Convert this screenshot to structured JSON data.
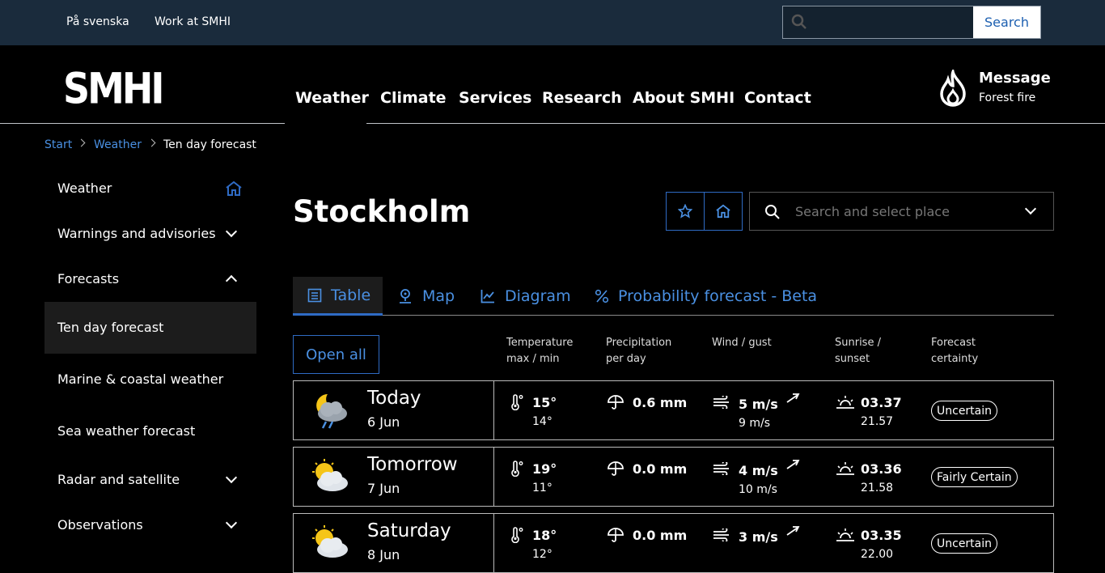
{
  "topbar": {
    "lang_link": "På svenska",
    "work_link": "Work at SMHI",
    "search_button": "Search",
    "search_placeholder": ""
  },
  "header": {
    "logo": "SMHI",
    "nav": [
      "Weather",
      "Climate",
      "Services",
      "Research",
      "About SMHI",
      "Contact"
    ],
    "message_title": "Message",
    "message_subtitle": "Forest fire"
  },
  "breadcrumb": [
    "Start",
    "Weather",
    "Ten day forecast"
  ],
  "sidebar": {
    "items": [
      {
        "label": "Weather"
      },
      {
        "label": "Warnings and advisories"
      },
      {
        "label": "Forecasts"
      },
      {
        "label": "Ten day forecast"
      },
      {
        "label": "Marine & coastal weather"
      },
      {
        "label": "Sea weather forecast"
      },
      {
        "label": "Radar and satellite"
      },
      {
        "label": "Observations"
      }
    ]
  },
  "main": {
    "city": "Stockholm",
    "place_search_placeholder": "Search and select place",
    "tabs": [
      "Table",
      "Map",
      "Diagram",
      "Probability forecast - Beta"
    ],
    "open_all": "Open all",
    "columns": {
      "temp": [
        "Temperature",
        "max / min"
      ],
      "precip": [
        "Precipitation",
        "per day"
      ],
      "wind": [
        "Wind / gust"
      ],
      "sun": [
        "Sunrise /",
        "sunset"
      ],
      "cert": [
        "Forecast",
        "certainty"
      ]
    },
    "rows": [
      {
        "day": "Today",
        "date": "6 Jun",
        "tmax": "15°",
        "tmin": "14°",
        "precip": "0.6 mm",
        "wind": "5 m/s",
        "gust": "9 m/s",
        "sunrise": "03.37",
        "sunset": "21.57",
        "certainty": "Uncertain"
      },
      {
        "day": "Tomorrow",
        "date": "7 Jun",
        "tmax": "19°",
        "tmin": "11°",
        "precip": "0.0 mm",
        "wind": "4 m/s",
        "gust": "10 m/s",
        "sunrise": "03.36",
        "sunset": "21.58",
        "certainty": "Fairly Certain"
      },
      {
        "day": "Saturday",
        "date": "8 Jun",
        "tmax": "18°",
        "tmin": "12°",
        "precip": "0.0 mm",
        "wind": "3 m/s",
        "gust": "",
        "sunrise": "03.35",
        "sunset": "22.00",
        "certainty": "Uncertain"
      }
    ]
  },
  "colors": {
    "accent": "#4a90e2",
    "topbar": "#1a2b3c"
  }
}
